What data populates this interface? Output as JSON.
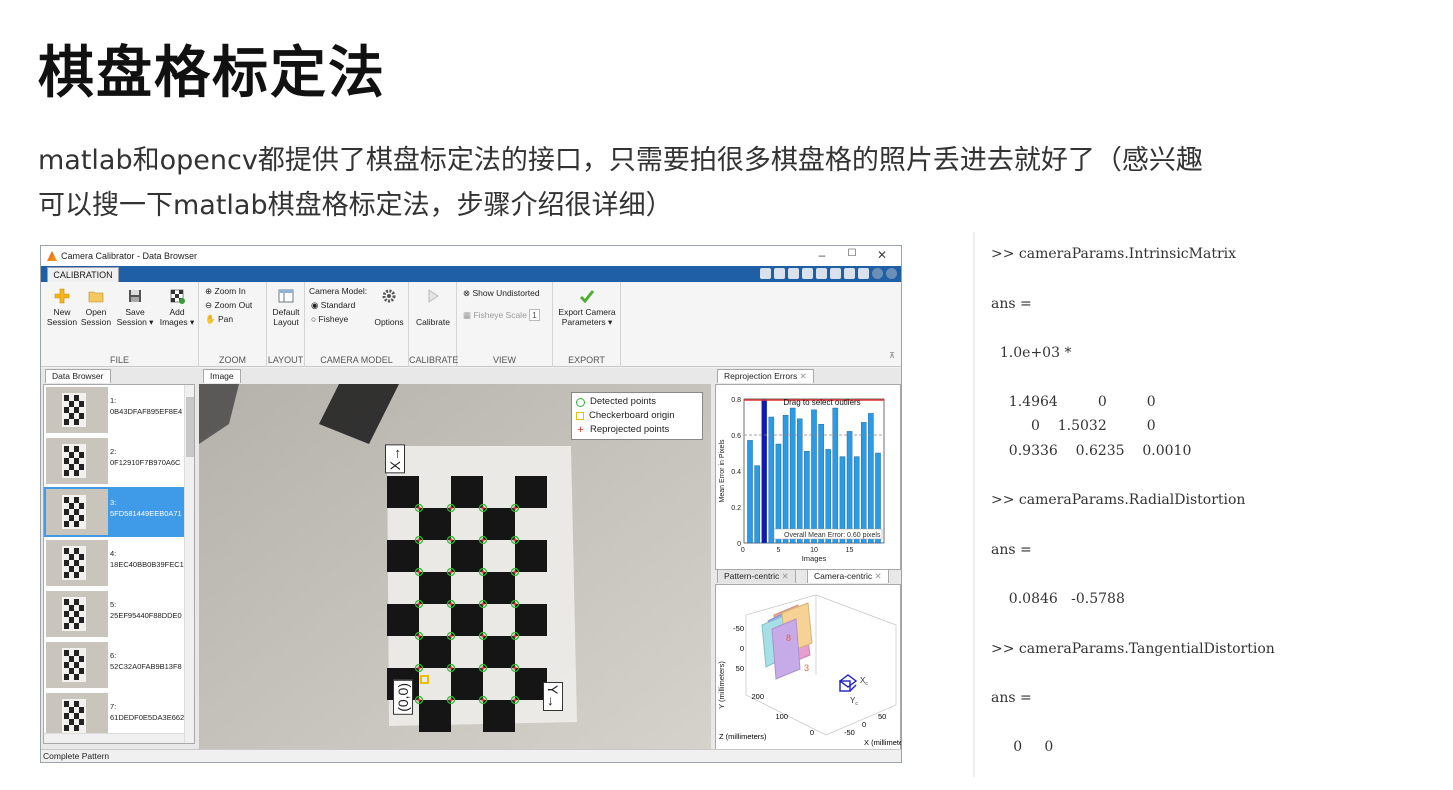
{
  "slide": {
    "title": "棋盘格标定法",
    "text_line1": "matlab和opencv都提供了棋盘标定法的接口，只需要拍很多棋盘格的照片丢进去就好了（感兴趣",
    "text_line2": "可以搜一下matlab棋盘格标定法，步骤介绍很详细）"
  },
  "window": {
    "title": "Camera Calibrator - Data Browser",
    "minimize": "–",
    "maximize": "☐",
    "close": "✕",
    "ribbon_tab": "CALIBRATION",
    "status": "Complete Pattern"
  },
  "ribbon": {
    "file": {
      "label": "FILE",
      "new_session": [
        "New",
        "Session"
      ],
      "open_session": [
        "Open",
        "Session"
      ],
      "save_session": [
        "Save",
        "Session ▾"
      ],
      "add_images": [
        "Add",
        "Images ▾"
      ]
    },
    "zoom": {
      "label": "ZOOM",
      "zoom_in": "Zoom In",
      "zoom_out": "Zoom Out",
      "pan": "Pan"
    },
    "layout": {
      "label": "LAYOUT",
      "default_layout": [
        "Default",
        "Layout"
      ]
    },
    "camera_model": {
      "label": "CAMERA MODEL",
      "title": "Camera Model:",
      "standard": "Standard",
      "fisheye": "Fisheye",
      "options": "Options"
    },
    "calibrate": {
      "label": "CALIBRATE",
      "calibrate": "Calibrate"
    },
    "view": {
      "label": "VIEW",
      "show_undistorted": "Show Undistorted",
      "fisheye_scale": "Fisheye Scale",
      "fisheye_scale_value": "1"
    },
    "export": {
      "label": "EXPORT",
      "export_camera": [
        "Export Camera",
        "Parameters ▾"
      ]
    }
  },
  "panes": {
    "data_browser_tab": "Data Browser",
    "image_tab": "Image",
    "reprojection_tab": "Reprojection Errors",
    "pattern_centric_tab": "Pattern-centric",
    "camera_centric_tab": "Camera-centric",
    "tab_close": "✕"
  },
  "data_browser": {
    "items": [
      {
        "index": "1:",
        "id": "0B43DFAF895EF8E4",
        "selected": false
      },
      {
        "index": "2:",
        "id": "0F12910F7B970A6C",
        "selected": false
      },
      {
        "index": "3:",
        "id": "5FD581449EEB0A71",
        "selected": true
      },
      {
        "index": "4:",
        "id": "18EC40BB0B39FEC1",
        "selected": false
      },
      {
        "index": "5:",
        "id": "25EF95440F88DDE0",
        "selected": false
      },
      {
        "index": "6:",
        "id": "52C32A0FAB9B13F8",
        "selected": false
      },
      {
        "index": "7:",
        "id": "61DEDF0E5DA3E662",
        "selected": false
      }
    ]
  },
  "image_view": {
    "legend": [
      "Detected points",
      "Checkerboard origin",
      "Reprojected points"
    ],
    "axis_x_label": "X→",
    "axis_y_label": "Y→",
    "origin_label": "(0,0)"
  },
  "reprojection": {
    "drag_text": "Drag to select outliers",
    "mean_text": "Overall Mean Error: 0.60 pixels",
    "ylabel": "Mean Error in Pixels",
    "xlabel": "Images",
    "yticks": [
      "0",
      "0.2",
      "0.4",
      "0.6",
      "0.8"
    ],
    "xticks": [
      "0",
      "5",
      "10",
      "15"
    ],
    "values": [
      0.57,
      0.43,
      0.8,
      0.7,
      0.55,
      0.71,
      0.75,
      0.69,
      0.51,
      0.74,
      0.66,
      0.52,
      0.75,
      0.48,
      0.62,
      0.48,
      0.67,
      0.72,
      0.5
    ],
    "highlight_index": 2,
    "mean": 0.6,
    "ymax": 0.8,
    "colors": {
      "bar": "#2a9be6",
      "bar_selected": "#1518b5",
      "mean_line": "#888888",
      "outlier_line": "#e03030"
    }
  },
  "camera_centric": {
    "y_label": "Y (millimeters)",
    "z_label": "Z (millimeters)",
    "x_label": "X (millimeters)",
    "y_ticks": [
      "-50",
      "0",
      "50"
    ],
    "z_ticks": [
      "200",
      "100",
      "0"
    ],
    "x_ticks": [
      "-50",
      "0",
      "50"
    ],
    "xc": "X",
    "yc": "Y",
    "sub": "c",
    "plane_labels": [
      "8",
      "3"
    ]
  },
  "console": {
    "lines": [
      ">> cameraParams.IntrinsicMatrix",
      "ans =",
      "  1.0e+03 *",
      "    1.4964         0         0",
      "         0    1.5032         0",
      "    0.9336    0.6235    0.0010",
      ">> cameraParams.RadialDistortion",
      "ans =",
      "    0.0846   -0.5788",
      ">> cameraParams.TangentialDistortion",
      "ans =",
      "     0     0"
    ]
  }
}
